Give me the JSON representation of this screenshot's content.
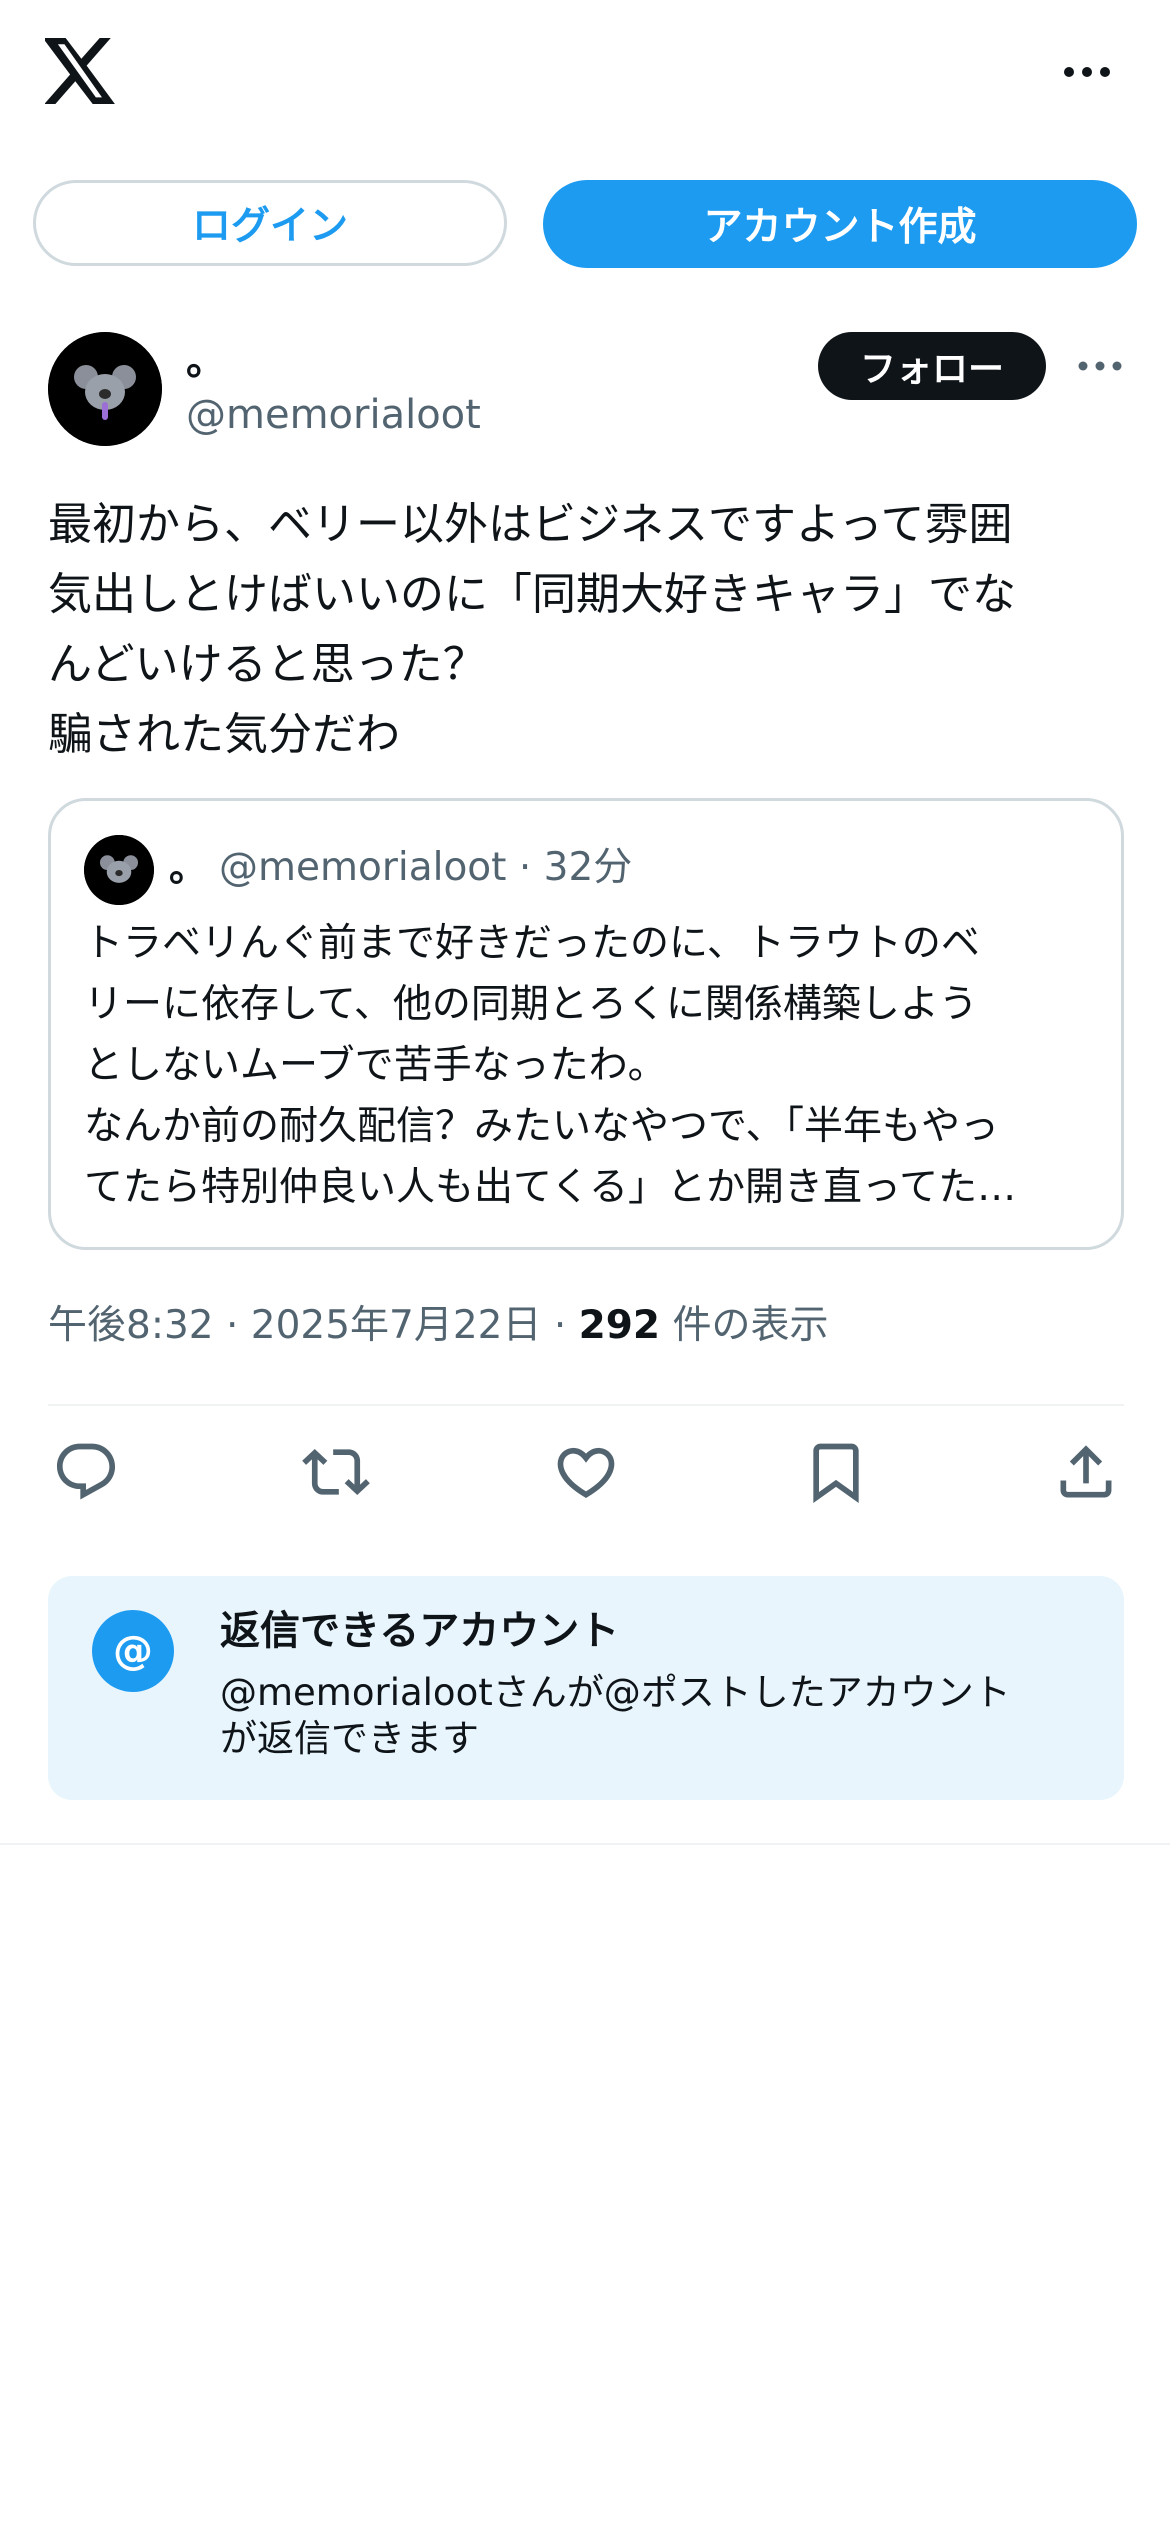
{
  "header": {
    "logo_icon": "x-logo-icon",
    "more_icon": "more-horizontal-icon"
  },
  "auth": {
    "login_label": "ログイン",
    "signup_label": "アカウント作成"
  },
  "post": {
    "display_name": "。",
    "handle": "@memorialoot",
    "follow_label": "フォロー",
    "text": "最初から、ベリー以外はビジネスですよって雰囲\n気出しとけばいいのに「同期大好きキャラ」でな\nんどいけると思った？\n騙された気分だわ",
    "timestamp": "午後8:32 · 2025年7月22日 · ",
    "views_count": "292",
    "views_label": " 件の表示"
  },
  "quote": {
    "display_name": "。",
    "meta": "@memorialoot · 32分",
    "text": "トラベリんぐ前まで好きだったのに、トラウトのベ\nリーに依存して、他の同期とろくに関係構築しよう\nとしないムーブで苦手なったわ。\nなんか前の耐久配信？みたいなやつで、「半年もやっ\nてたら特別仲良い人も出てくる」とか開き直ってた…"
  },
  "actions": [
    {
      "icon": "reply-icon"
    },
    {
      "icon": "repost-icon"
    },
    {
      "icon": "like-icon"
    },
    {
      "icon": "bookmark-icon"
    },
    {
      "icon": "share-icon"
    }
  ],
  "reply_restriction": {
    "icon_text": "@",
    "title": "返信できるアカウント",
    "description": "@memorialootさんが@ポストしたアカウント\nが返信できます"
  },
  "colors": {
    "accent": "#1d9bf0",
    "text_primary": "#0f1419",
    "text_secondary": "#536471",
    "border": "#cfd9de",
    "reply_box_bg": "#e8f5fd"
  }
}
